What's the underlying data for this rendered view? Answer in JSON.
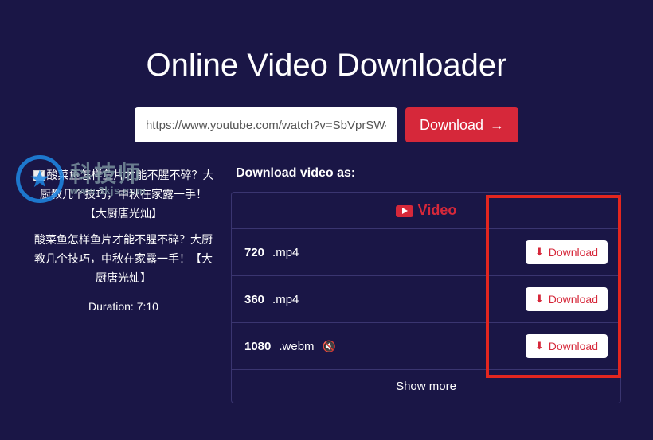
{
  "title": "Online Video Downloader",
  "input": {
    "value": "https://www.youtube.com/watch?v=SbVprSW-"
  },
  "download_btn": "Download",
  "watermark": {
    "cn": "科技师",
    "url": "www.3kjs.com"
  },
  "left": {
    "thumb_alt": "酸菜鱼怎样鱼片才能不腥不碎？大厨教几个技巧，中秋在家露一手！【大厨唐光灿】",
    "video_title": "酸菜鱼怎样鱼片才能不腥不碎？大厨教几个技巧，中秋在家露一手！【大厨唐光灿】",
    "duration": "Duration: 7:10"
  },
  "section_label": "Download video as:",
  "video_header": "Video",
  "formats": [
    {
      "res": "720",
      "ext": ".mp4",
      "muted": false,
      "btn": "Download"
    },
    {
      "res": "360",
      "ext": ".mp4",
      "muted": false,
      "btn": "Download"
    },
    {
      "res": "1080",
      "ext": ".webm",
      "muted": true,
      "btn": "Download"
    }
  ],
  "show_more": "Show more"
}
